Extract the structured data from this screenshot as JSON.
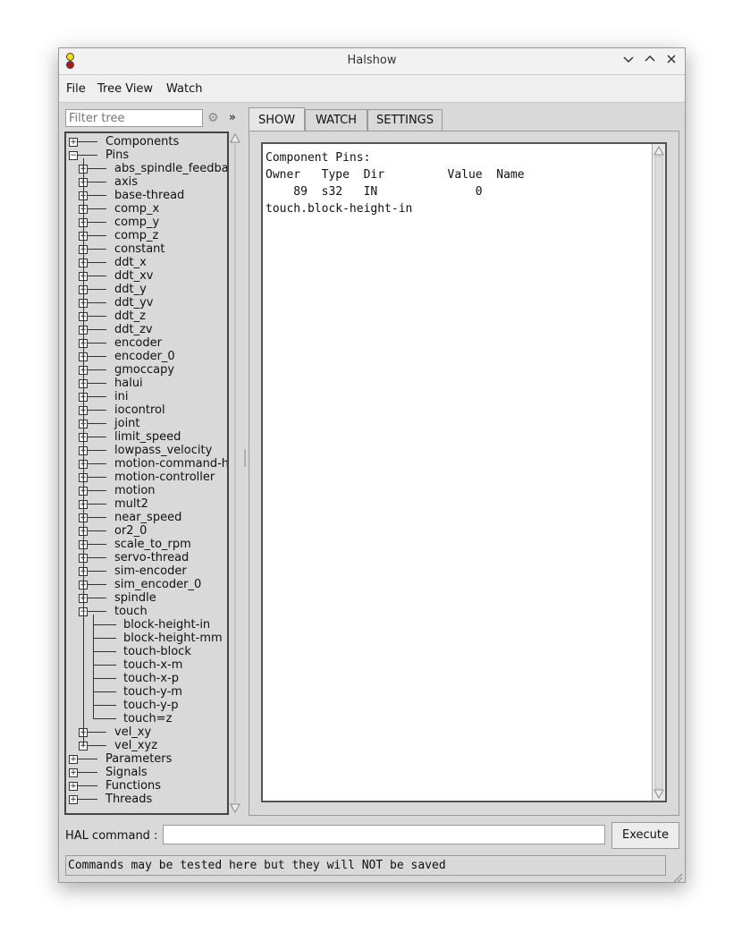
{
  "window": {
    "title": "Halshow"
  },
  "menu": [
    "File",
    "Tree View",
    "Watch"
  ],
  "filter": {
    "placeholder": "Filter tree",
    "expand_label": "»"
  },
  "tree": {
    "top": [
      "Components",
      "Pins",
      "Parameters",
      "Signals",
      "Functions",
      "Threads"
    ],
    "pins_children": [
      "abs_spindle_feedba",
      "axis",
      "base-thread",
      "comp_x",
      "comp_y",
      "comp_z",
      "constant",
      "ddt_x",
      "ddt_xv",
      "ddt_y",
      "ddt_yv",
      "ddt_z",
      "ddt_zv",
      "encoder",
      "encoder_0",
      "gmoccapy",
      "halui",
      "ini",
      "iocontrol",
      "joint",
      "limit_speed",
      "lowpass_velocity",
      "motion-command-h",
      "motion-controller",
      "motion",
      "mult2",
      "near_speed",
      "or2_0",
      "scale_to_rpm",
      "servo-thread",
      "sim-encoder",
      "sim_encoder_0",
      "spindle",
      "touch",
      "vel_xy",
      "vel_xyz"
    ],
    "touch_children": [
      "block-height-in",
      "block-height-mm",
      "touch-block",
      "touch-x-m",
      "touch-x-p",
      "touch-y-m",
      "touch-y-p",
      "touch=z"
    ]
  },
  "tabs": [
    "SHOW",
    "WATCH",
    "SETTINGS"
  ],
  "show": {
    "heading": "Component Pins:",
    "columns": "Owner   Type  Dir         Value  Name",
    "row": "    89  s32   IN              0",
    "pin_name": "touch.block-height-in"
  },
  "hal_command": {
    "label": "HAL command :",
    "value": "",
    "execute_label": "Execute"
  },
  "status": "Commands may be tested here but they will NOT be saved",
  "colors": {
    "window_bg": "#d9d9d9",
    "titlebar_bg": "#f2f2f2",
    "icon_yellow": "#f2e200",
    "icon_red": "#b01818"
  }
}
